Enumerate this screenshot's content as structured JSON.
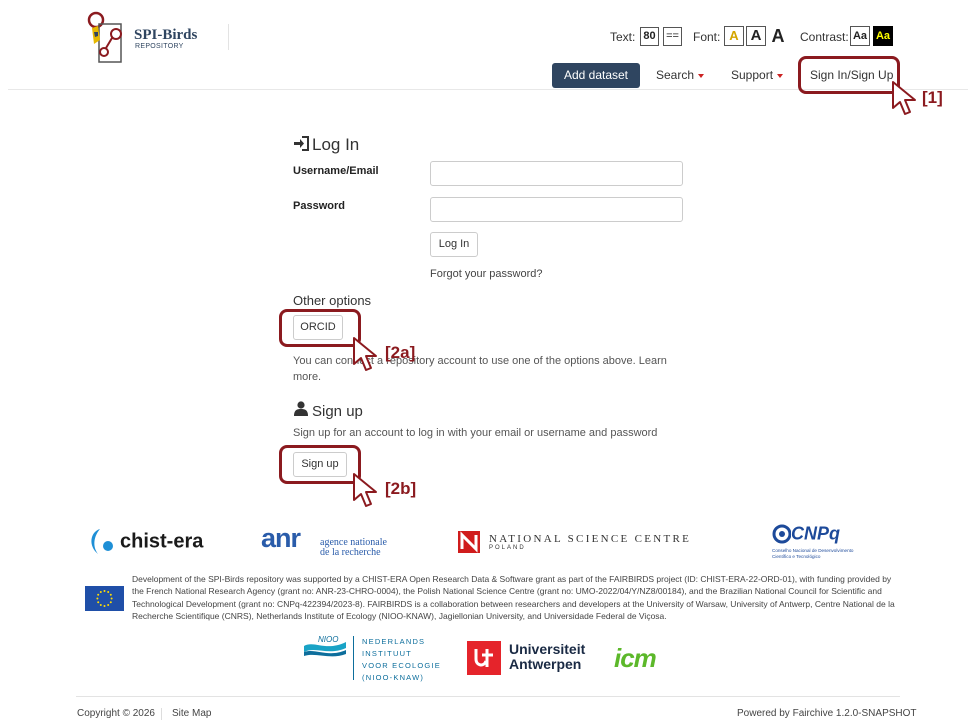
{
  "header": {
    "logo_title": "SPI-Birds",
    "logo_subtitle": "REPOSITORY",
    "accessibility": {
      "text_label": "Text:",
      "text_size": "80",
      "text_equal": "==",
      "font_label": "Font:",
      "font_opt1": "A",
      "font_opt2": "A",
      "font_opt3": "A",
      "contrast_label": "Contrast:",
      "contrast_normal": "Aa",
      "contrast_high": "Aa"
    },
    "nav": {
      "add_dataset": "Add dataset",
      "search": "Search",
      "support": "Support",
      "sign_in": "Sign In/Sign Up"
    }
  },
  "annotations": {
    "a1": "[1]",
    "a2a": "[2a]",
    "a2b": "[2b]"
  },
  "login": {
    "title": "Log In",
    "username_label": "Username/Email",
    "password_label": "Password",
    "login_button": "Log In",
    "forgot_link": "Forgot your password?",
    "other_options_title": "Other options",
    "orcid_button": "ORCID",
    "other_text_line1": "You can connect a repository account to use one of the options above. Learn",
    "other_text_line2": "more."
  },
  "signup": {
    "title": "Sign up",
    "text": "Sign up for an account to log in with your email or username and password",
    "button": "Sign up"
  },
  "footer": {
    "logos": {
      "chist": "chist-era",
      "anr": "anr",
      "anr_line1": "agence nationale",
      "anr_line2": "de la recherche",
      "ncn": "NATIONAL SCIENCE CENTRE",
      "ncn_sub": "POLAND",
      "cnpq": "CNPq",
      "cnpq_sub1": "Conselho Nacional de Desenvolvimento",
      "cnpq_sub2": "Científico e Tecnológico",
      "nioo_mark": "NIOO",
      "nioo_l1": "NEDERLANDS",
      "nioo_l2": "INSTITUUT",
      "nioo_l3": "VOOR ECOLOGIE",
      "nioo_l4": "(NIOO-KNAW)",
      "ua_l1": "Universiteit",
      "ua_l2": "Antwerpen",
      "icm": "icm"
    },
    "funding_text": "Development of the SPI-Birds repository was supported by a CHIST-ERA Open Research Data & Software grant as part of the FAIRBIRDS project (ID: CHIST-ERA-22-ORD-01), with funding provided by the French National Research Agency (grant no: ANR-23-CHRO-0004), the Polish National Science Centre (grant no: UMO-2022/04/Y/NZ8/00184), and the Brazilian National Council for Scientific and Technological Development (grant no: CNPq-422394/2023-8). FAIRBIRDS is a collaboration between researchers and developers at the University of Warsaw, University of Antwerp, Centre National de la Recherche Scientifique (CNRS), Netherlands Institute of Ecology (NIOO-KNAW), Jagiellonian University, and Universidade Federal de Viçosa.",
    "copyright": "Copyright © 2026",
    "sitemap": "Site Map",
    "powered": "Powered by Fairchive 1.2.0-SNAPSHOT"
  },
  "colors": {
    "accent": "#2f4560",
    "highlight": "#8b1a1f",
    "caret": "#cc2222"
  }
}
